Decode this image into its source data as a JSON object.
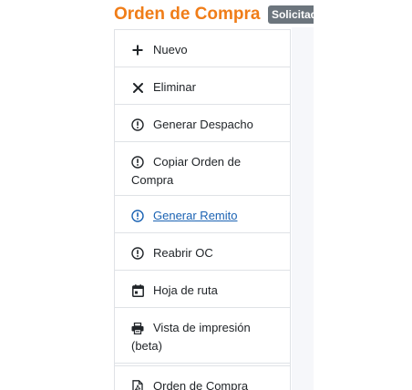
{
  "header": {
    "title": "Orden de Compra",
    "status_badge": "Solicitada"
  },
  "menu": {
    "items": [
      {
        "label": "Nuevo",
        "icon": "plus-icon"
      },
      {
        "label": "Eliminar",
        "icon": "close-icon"
      },
      {
        "label": "Generar Despacho",
        "icon": "exclamation-circle-icon"
      },
      {
        "label": "Copiar Orden de Compra",
        "icon": "exclamation-circle-icon"
      },
      {
        "label": "Generar Remito",
        "icon": "exclamation-circle-icon"
      },
      {
        "label": "Reabrir OC",
        "icon": "exclamation-circle-icon"
      },
      {
        "label": "Hoja de ruta",
        "icon": "calendar-icon"
      },
      {
        "label": "Vista de impresión (beta)",
        "icon": "printer-icon"
      },
      {
        "label": "Orden de Compra",
        "icon": "pdf-file-icon"
      }
    ]
  },
  "colors": {
    "title": "#f07d18",
    "badge_bg": "#6c757d",
    "link": "#1a62b3",
    "border": "#dfe2e6"
  }
}
